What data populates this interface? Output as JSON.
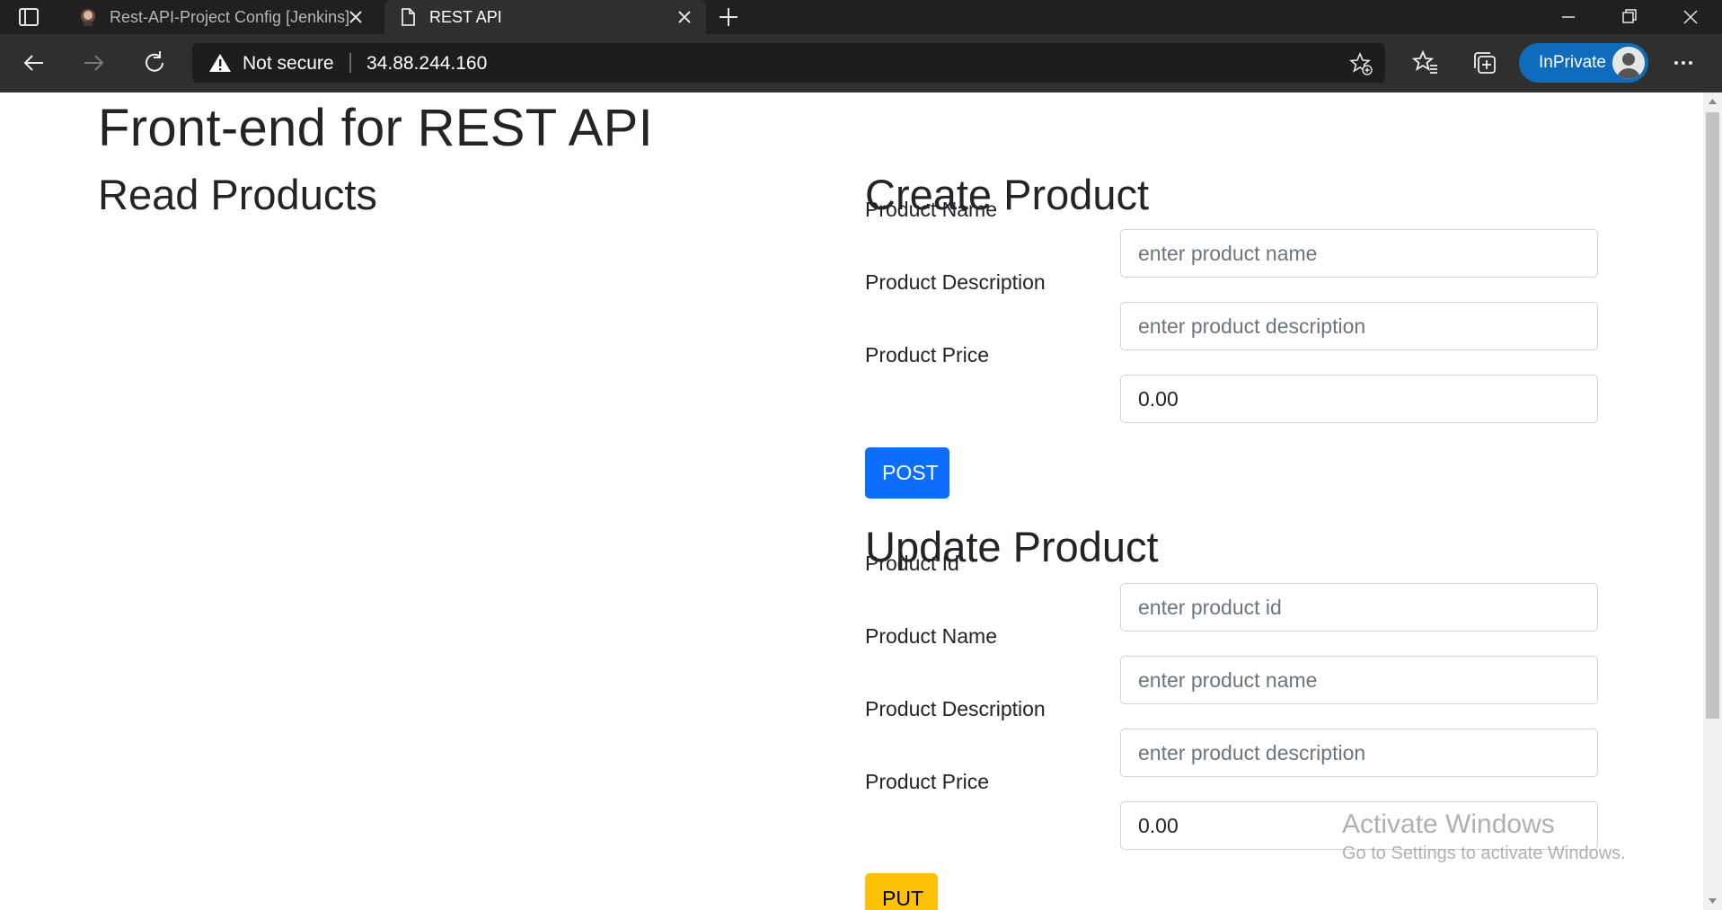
{
  "browser": {
    "tabs": [
      {
        "title": "Rest-API-Project Config [Jenkins]",
        "active": false
      },
      {
        "title": "REST API",
        "active": true
      }
    ],
    "address": {
      "security_label": "Not secure",
      "url": "34.88.244.160"
    },
    "inprivate_label": "InPrivate",
    "colors": {
      "tabbar": "#202020",
      "toolbar": "#2f2f2f",
      "inprivate": "#0f6cbd"
    }
  },
  "page": {
    "title": "Front-end for REST API",
    "read_heading": "Read Products",
    "create": {
      "heading": "Create Product",
      "name_label": "Product Name",
      "name_placeholder": "enter product name",
      "desc_label": "Product Description",
      "desc_placeholder": "enter product description",
      "price_label": "Product Price",
      "price_value": "0.00",
      "button_label": "POST",
      "button_color": "#0d6efd"
    },
    "update": {
      "heading": "Update Product",
      "id_label": "Product Id",
      "id_placeholder": "enter product id",
      "name_label": "Product Name",
      "name_placeholder": "enter product name",
      "desc_label": "Product Description",
      "desc_placeholder": "enter product description",
      "price_label": "Product Price",
      "price_value": "0.00",
      "button_label": "PUT",
      "button_color": "#ffc107"
    }
  },
  "watermark": {
    "line1": "Activate Windows",
    "line2": "Go to Settings to activate Windows."
  },
  "icons": [
    "sidebar-toggle-icon",
    "jenkins-favicon-icon",
    "page-favicon-icon",
    "close-icon",
    "plus-icon",
    "minimize-icon",
    "restore-icon",
    "close-window-icon",
    "back-arrow-icon",
    "forward-arrow-icon",
    "refresh-icon",
    "warning-icon",
    "add-favorite-icon",
    "favorites-icon",
    "collections-icon",
    "profile-avatar-icon",
    "more-icon"
  ]
}
